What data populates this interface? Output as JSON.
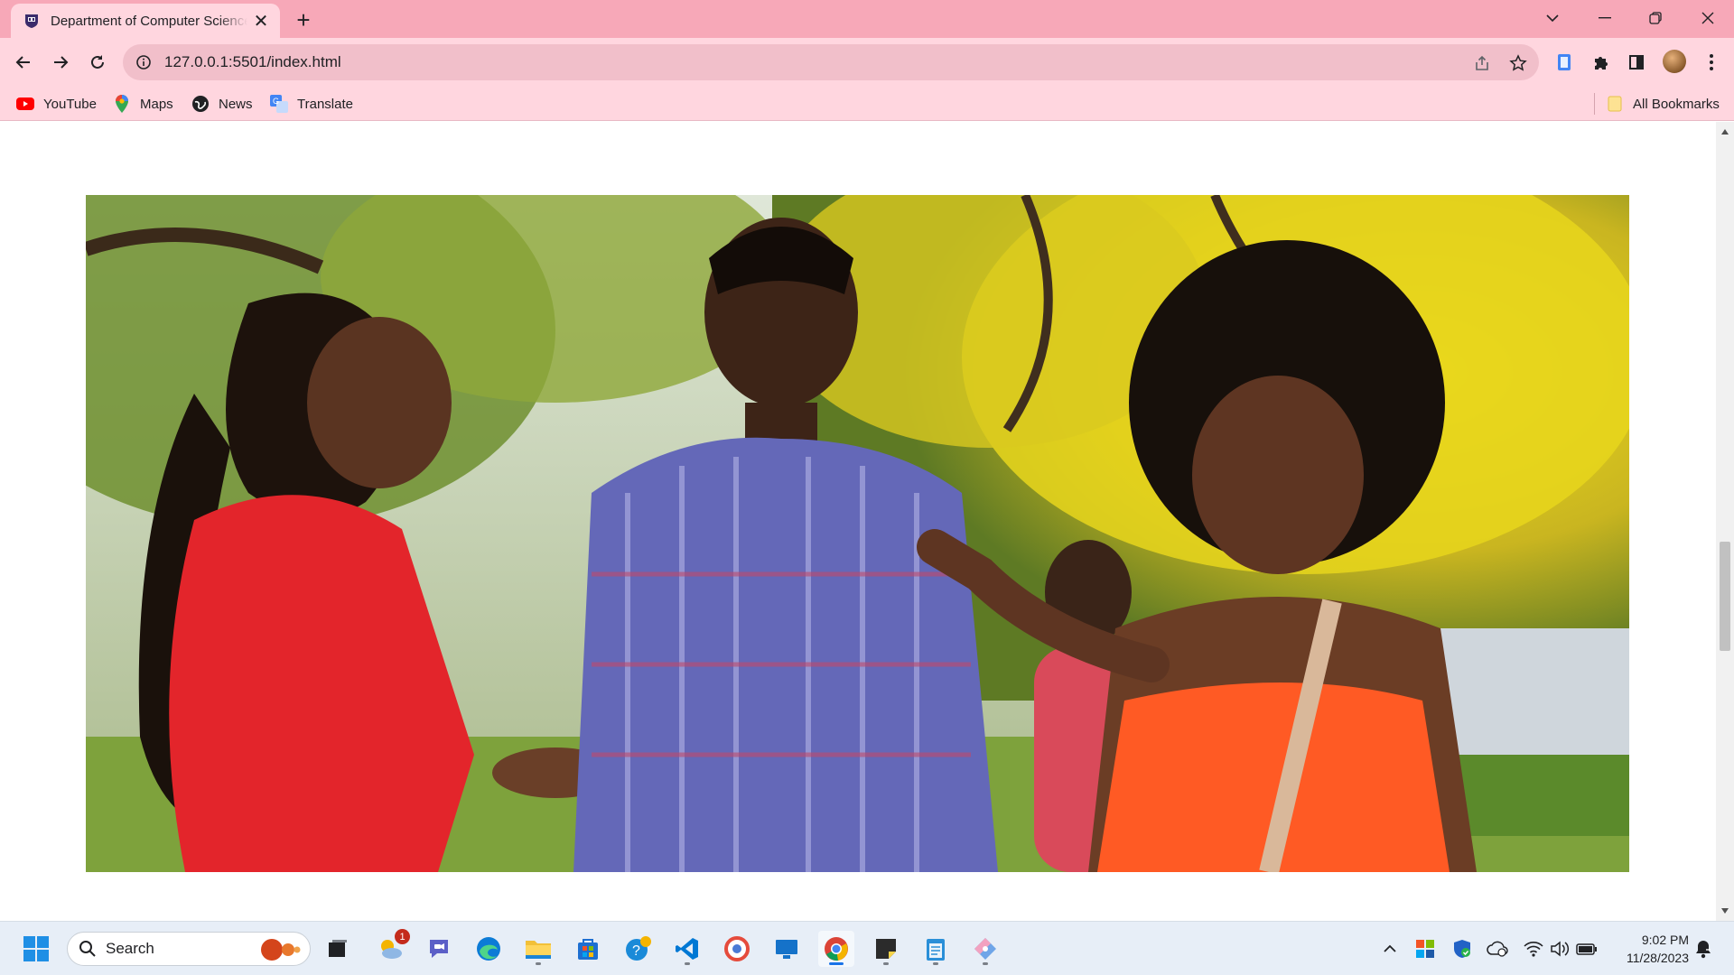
{
  "browser": {
    "tab": {
      "title": "Department of Computer Science",
      "favicon": "university-crest-icon"
    },
    "new_tab": "+",
    "address": {
      "url": "127.0.0.1:5501/index.html"
    },
    "bookmarks": [
      {
        "label": "YouTube",
        "icon": "youtube-icon"
      },
      {
        "label": "Maps",
        "icon": "maps-icon"
      },
      {
        "label": "News",
        "icon": "news-icon"
      },
      {
        "label": "Translate",
        "icon": "translate-icon"
      }
    ],
    "all_bookmarks": "All Bookmarks",
    "theme_colors": {
      "tabstrip": "#f7a8b8",
      "toolbar": "#ffd6df",
      "omnibox": "#f1bfca"
    }
  },
  "page": {
    "hero_image": {
      "description_icon": "students-photo",
      "alt": ""
    }
  },
  "taskbar": {
    "search_label": "Search",
    "chat_badge": "1",
    "clock": {
      "time": "9:02 PM",
      "date": "11/28/2023"
    }
  }
}
